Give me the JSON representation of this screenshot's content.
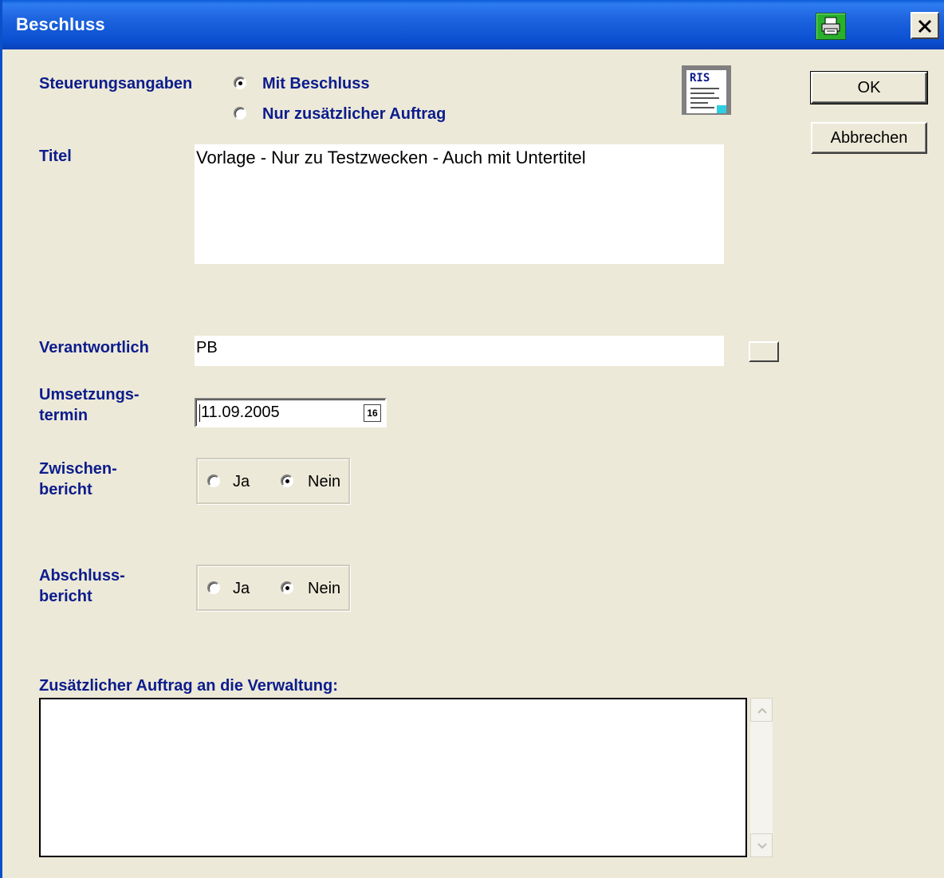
{
  "window": {
    "title": "Beschluss"
  },
  "toolbar": {
    "print_icon": "printer-icon",
    "close_icon": "close-icon"
  },
  "steuerung": {
    "label": "Steuerungsangaben",
    "options": [
      {
        "label": "Mit Beschluss",
        "selected": true
      },
      {
        "label": "Nur zusätzlicher Auftrag",
        "selected": false
      }
    ]
  },
  "logo": {
    "text": "RIS"
  },
  "buttons": {
    "ok": "OK",
    "cancel": "Abbrechen"
  },
  "titel": {
    "label": "Titel",
    "value": "Vorlage - Nur zu Testzwecken -  Auch mit Untertitel"
  },
  "verantwortlich": {
    "label": "Verantwortlich",
    "value": "PB"
  },
  "umsetzung": {
    "label_line1": "Umsetzungs-",
    "label_line2": "termin",
    "value": "11.09.2005",
    "calendar_day": "16"
  },
  "zwischenbericht": {
    "label_line1": "Zwischen-",
    "label_line2": "bericht",
    "options": [
      "Ja",
      "Nein"
    ],
    "selected": "Nein"
  },
  "abschlussbericht": {
    "label_line1": "Abschluss-",
    "label_line2": "bericht",
    "options": [
      "Ja",
      "Nein"
    ],
    "selected": "Nein"
  },
  "auftrag": {
    "label": "Zusätzlicher Auftrag an die Verwaltung:",
    "value": ""
  },
  "colors": {
    "titlebar": "#0a4ed0",
    "label": "#0c1c8c",
    "face": "#ece9d8"
  }
}
